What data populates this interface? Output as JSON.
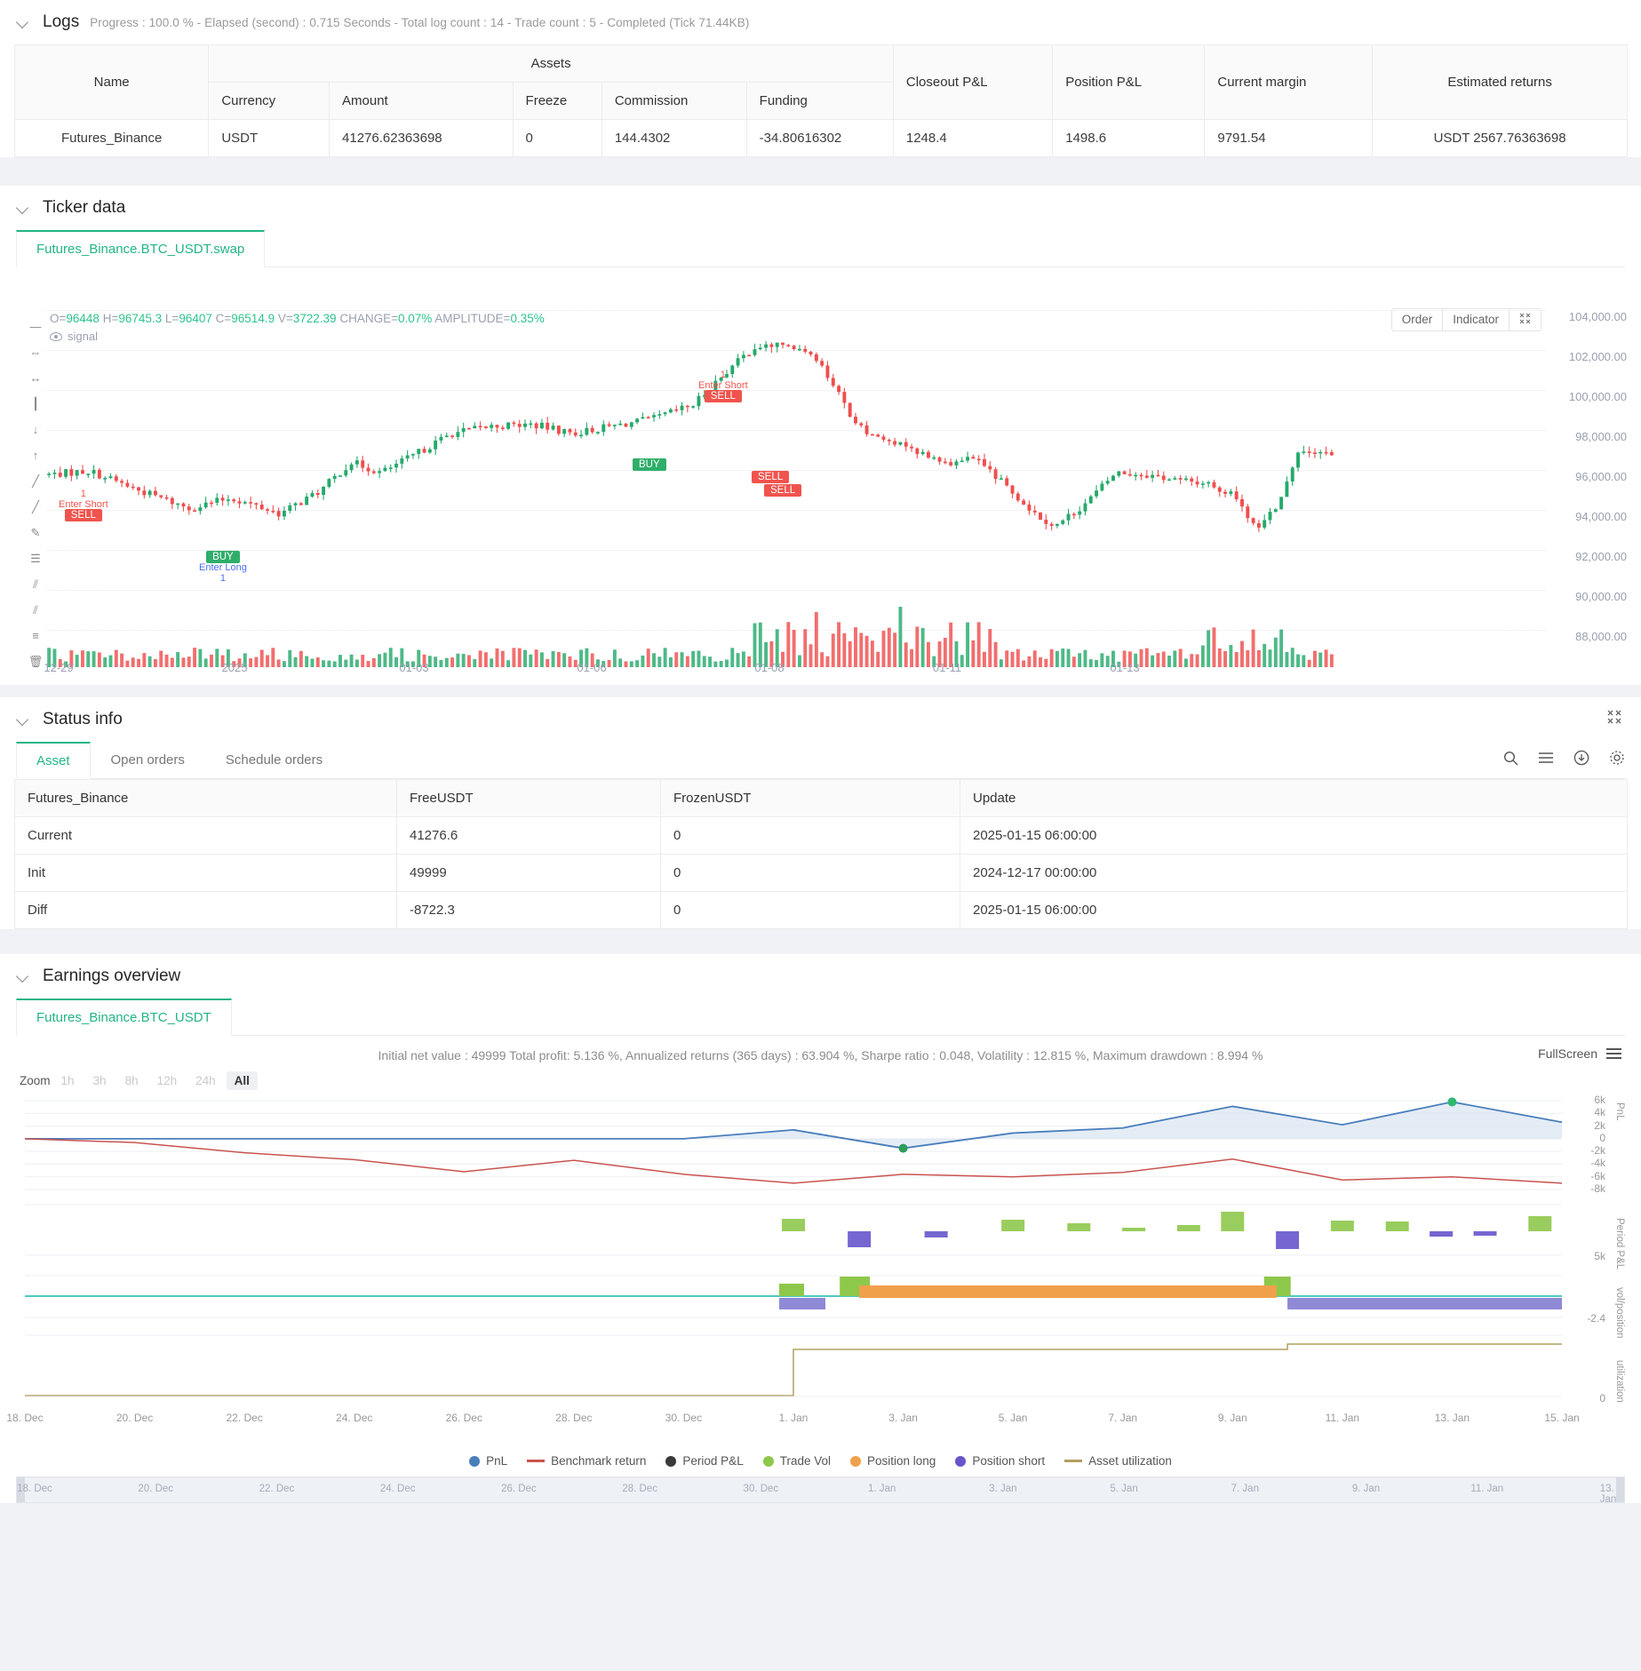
{
  "logs": {
    "title": "Logs",
    "summary": "Progress : 100.0 % - Elapsed (second) : 0.715  Seconds - Total log count : 14 - Trade count : 5 - Completed (Tick 71.44KB)"
  },
  "assets_table": {
    "group_header": "Assets",
    "headers": {
      "name": "Name",
      "currency": "Currency",
      "amount": "Amount",
      "freeze": "Freeze",
      "commission": "Commission",
      "funding": "Funding",
      "closeout_pnl": "Closeout P&L",
      "position_pnl": "Position P&L",
      "current_margin": "Current margin",
      "estimated_returns": "Estimated returns"
    },
    "rows": [
      {
        "name": "Futures_Binance",
        "currency": "USDT",
        "amount": "41276.62363698",
        "freeze": "0",
        "commission": "144.4302",
        "funding": "-34.80616302",
        "closeout_pnl": "1248.4",
        "position_pnl": "1498.6",
        "current_margin": "9791.54",
        "estimated_returns": "USDT 2567.76363698"
      }
    ]
  },
  "ticker": {
    "title": "Ticker data",
    "tabs": [
      {
        "label": "Futures_Binance.BTC_USDT.swap",
        "active": true
      }
    ],
    "ohlc": {
      "o_label": "O=",
      "o": "96448",
      "h_label": "H=",
      "h": "96745.3",
      "l_label": "L=",
      "l": "96407",
      "c_label": "C=",
      "c": "96514.9",
      "v_label": "V=",
      "v": "3722.39",
      "change_label": "CHANGE=",
      "change": "0.07%",
      "amplitude_label": "AMPLITUDE=",
      "amplitude": "0.35%"
    },
    "signal_label": "signal",
    "controls": [
      "Order",
      "Indicator"
    ],
    "fullscreen_icon": "expand-icon",
    "price_axis": [
      "104,000.00",
      "102,000.00",
      "100,000.00",
      "98,000.00",
      "96,000.00",
      "94,000.00",
      "92,000.00",
      "90,000.00",
      "88,000.00"
    ],
    "date_axis": [
      "12-29",
      "2025",
      "01-03",
      "01-06",
      "01-08",
      "01-11",
      "01-13"
    ],
    "markers": [
      {
        "type": "SELL",
        "label": "Enter Short",
        "count": "1"
      },
      {
        "type": "BUY",
        "label": "Enter Long",
        "count": "1"
      },
      {
        "type": "SELL",
        "label": "Enter Short",
        "count": "1"
      },
      {
        "type": "BUY",
        "label": "",
        "count": ""
      },
      {
        "type": "SELL",
        "label": "",
        "count": ""
      },
      {
        "type": "SELL",
        "label": "",
        "count": ""
      }
    ]
  },
  "status_info": {
    "title": "Status info",
    "tabs": [
      {
        "label": "Asset",
        "active": true
      },
      {
        "label": "Open orders",
        "active": false
      },
      {
        "label": "Schedule orders",
        "active": false
      }
    ],
    "headers": [
      "Futures_Binance",
      "FreeUSDT",
      "FrozenUSDT",
      "Update"
    ],
    "rows": [
      {
        "name": "Current",
        "free": "41276.6",
        "frozen": "0",
        "update": "2025-01-15 06:00:00",
        "style": "blue"
      },
      {
        "name": "Init",
        "free": "49999",
        "frozen": "0",
        "update": "2024-12-17 00:00:00",
        "style": "plain"
      },
      {
        "name": "Diff",
        "free": "-8722.3",
        "frozen": "0",
        "update": "2025-01-15 06:00:00",
        "style": "red"
      }
    ]
  },
  "earnings": {
    "title": "Earnings overview",
    "tabs": [
      {
        "label": "Futures_Binance.BTC_USDT",
        "active": true
      }
    ],
    "stats": "Initial net value : 49999 Total profit: 5.136 %, Annualized returns (365 days) : 63.904 %, Sharpe ratio : 0.048, Volatility : 12.815 %, Maximum drawdown : 8.994 %",
    "fullscreen_label": "FullScreen",
    "zoom_label": "Zoom",
    "zoom_options": [
      {
        "label": "1h",
        "active": false
      },
      {
        "label": "3h",
        "active": false
      },
      {
        "label": "8h",
        "active": false
      },
      {
        "label": "12h",
        "active": false
      },
      {
        "label": "24h",
        "active": false
      },
      {
        "label": "All",
        "active": true
      }
    ],
    "legend": [
      {
        "label": "PnL",
        "color": "#4a7ebb",
        "shape": "dot"
      },
      {
        "label": "Benchmark return",
        "color": "#c9534f",
        "shape": "line"
      },
      {
        "label": "Period P&L",
        "color": "#3a3a3a",
        "shape": "dot"
      },
      {
        "label": "Trade Vol",
        "color": "#8ec84b",
        "shape": "dot"
      },
      {
        "label": "Position long",
        "color": "#f0a04b",
        "shape": "dot"
      },
      {
        "label": "Position short",
        "color": "#6655cc",
        "shape": "dot"
      },
      {
        "label": "Asset utilization",
        "color": "#b0a060",
        "shape": "line"
      }
    ],
    "axis_names": [
      "PnL",
      "Period P&L",
      "vol/position",
      "utilization"
    ],
    "y_ticks_pnl": [
      "6k",
      "4k",
      "2k",
      "0",
      "-2k",
      "-4k",
      "-6k",
      "-8k"
    ],
    "y_ticks_other": [
      "5k",
      "-2.4",
      "0"
    ],
    "date_axis": [
      "18. Dec",
      "20. Dec",
      "22. Dec",
      "24. Dec",
      "26. Dec",
      "28. Dec",
      "30. Dec",
      "1. Jan",
      "3. Jan",
      "5. Jan",
      "7. Jan",
      "9. Jan",
      "11. Jan",
      "13. Jan",
      "15. Jan"
    ],
    "nav_date_axis": [
      "18. Dec",
      "20. Dec",
      "22. Dec",
      "24. Dec",
      "26. Dec",
      "28. Dec",
      "30. Dec",
      "1. Jan",
      "3. Jan",
      "5. Jan",
      "7. Jan",
      "9. Jan",
      "11. Jan",
      "13. Jan"
    ]
  },
  "chart_data": {
    "type": "line",
    "title": "Earnings overview",
    "xlabel": "",
    "ylabel": "PnL",
    "x": [
      "18. Dec",
      "20. Dec",
      "22. Dec",
      "24. Dec",
      "26. Dec",
      "28. Dec",
      "30. Dec",
      "1. Jan",
      "3. Jan",
      "5. Jan",
      "7. Jan",
      "9. Jan",
      "11. Jan",
      "13. Jan",
      "15. Jan"
    ],
    "ylim": [
      -8000,
      6000
    ],
    "grid": true,
    "legend_position": "bottom",
    "series": [
      {
        "name": "PnL",
        "color": "#4a7ebb",
        "values": [
          0,
          0,
          0,
          0,
          0,
          0,
          0,
          1400,
          -1500,
          900,
          1700,
          5100,
          2200,
          5800,
          2600
        ]
      },
      {
        "name": "Benchmark return",
        "color": "#c9534f",
        "values": [
          0,
          -600,
          -2200,
          -3300,
          -5200,
          -3400,
          -5600,
          -7000,
          -5600,
          -6000,
          -5300,
          -3200,
          -6500,
          -6000,
          -7000
        ]
      },
      {
        "name": "Period P&L",
        "color": "#3a3a3a",
        "values": [
          0,
          0,
          0,
          0,
          0,
          0,
          0,
          800,
          -900,
          600,
          400,
          1800,
          -1400,
          900,
          -1200
        ]
      },
      {
        "name": "Trade Vol",
        "color": "#8ec84b",
        "values": [
          0,
          0,
          0,
          0,
          0,
          0,
          0,
          900,
          700,
          500,
          300,
          1600,
          600,
          400,
          1100
        ]
      },
      {
        "name": "Position long",
        "color": "#f0a04b",
        "values": [
          0,
          0,
          0,
          0,
          0,
          0,
          0,
          1,
          1,
          1,
          1,
          1,
          0,
          0,
          0
        ]
      },
      {
        "name": "Position short",
        "color": "#6655cc",
        "values": [
          0,
          0,
          0,
          0,
          0,
          0,
          0,
          -1,
          0,
          0,
          0,
          0,
          -1,
          -1,
          -1
        ]
      },
      {
        "name": "Asset utilization",
        "color": "#b0a060",
        "values": [
          0,
          0,
          0,
          0,
          0,
          0,
          0,
          0.9,
          0.9,
          0.9,
          0.9,
          0.95,
          0.95,
          0.95,
          0.95
        ]
      }
    ],
    "candles": {
      "type": "candlestick",
      "symbol": "Futures_Binance.BTC_USDT.swap",
      "x_ticks": [
        "12-29",
        "2025",
        "01-03",
        "01-06",
        "01-08",
        "01-11",
        "01-13"
      ],
      "y_ticks": [
        88000,
        90000,
        92000,
        94000,
        96000,
        98000,
        100000,
        102000,
        104000
      ],
      "last_ohlc": {
        "open": 96448,
        "high": 96745.3,
        "low": 96407,
        "close": 96514.9,
        "volume": 3722.39,
        "change_pct": 0.07,
        "amplitude_pct": 0.35
      }
    }
  }
}
